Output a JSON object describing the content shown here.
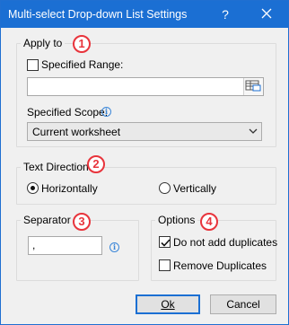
{
  "window": {
    "title": "Multi-select Drop-down List Settings",
    "help_label": "?",
    "accent": "#1b6fd3"
  },
  "apply_to": {
    "legend": "Apply to",
    "badge": "1",
    "specified_range_label": "Specified Range:",
    "specified_range_checked": false,
    "range_value": "",
    "range_picker_icon": "range-picker-icon",
    "specified_scope_label": "Specified Scope:",
    "scope_value": "Current worksheet"
  },
  "text_direction": {
    "legend": "Text Direction",
    "badge": "2",
    "horizontally_label": "Horizontally",
    "vertically_label": "Vertically",
    "selected": "Horizontally"
  },
  "separator": {
    "legend": "Separator",
    "badge": "3",
    "value": ","
  },
  "options": {
    "legend": "Options",
    "badge": "4",
    "do_not_add_duplicates_label": "Do not add duplicates",
    "do_not_add_duplicates_checked": true,
    "remove_duplicates_label": "Remove Duplicates",
    "remove_duplicates_checked": false
  },
  "buttons": {
    "ok_label": "Ok",
    "cancel_label": "Cancel"
  },
  "colors": {
    "badge_red": "#e8343c",
    "info_blue": "#3a86d8"
  }
}
